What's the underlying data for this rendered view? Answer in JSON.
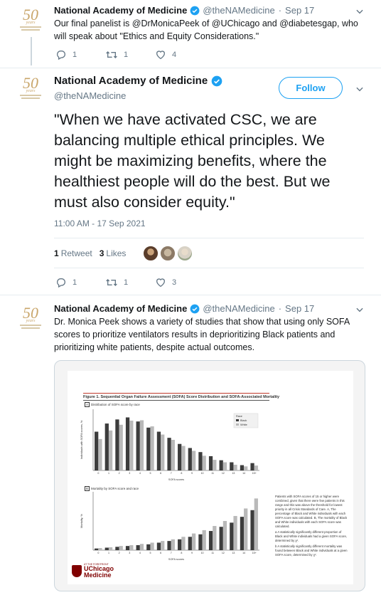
{
  "tweets": [
    {
      "author": "National Academy of Medicine",
      "handle": "@theNAMedicine",
      "separator": "·",
      "time": "Sep 17",
      "text_line1": "Our final panelist is @DrMonicaPeek of @UChicago and @diabetesgap, who",
      "text_line2": "will speak about \"Ethics and Equity Considerations.\"",
      "replies": "1",
      "retweets": "1",
      "likes": "4"
    },
    {
      "author": "National Academy of Medicine",
      "handle": "@theNAMedicine",
      "follow_label": "Follow",
      "text_lines": [
        "\"When we have activated CSC, we are",
        "balancing multiple ethical principles. We",
        "might be maximizing benefits, where the",
        "healthiest people will do the best. But we",
        "must also consider equity.\""
      ],
      "timestamp": "11:00 AM - 17 Sep 2021",
      "retweet_count": "1",
      "retweet_label": "Retweet",
      "like_count": "3",
      "like_label": "Likes",
      "replies": "1",
      "retweets": "1",
      "likes": "3"
    },
    {
      "author": "National Academy of Medicine",
      "handle": "@theNAMedicine",
      "separator": "·",
      "time": "Sep 17",
      "text_lines": [
        "Dr. Monica Peek shows a variety of studies that show that using only SOFA",
        "scores to prioritize ventilators results in deprioritizing Black patients and",
        "prioritizing white patients, despite actual outcomes."
      ]
    }
  ],
  "logo": {
    "fifty": "50",
    "years": "years"
  },
  "figure": {
    "title": "Figure 1. Sequential Organ Failure Assessment (SOFA) Score Distribution and SOFA-Associated Mortality",
    "panel_a_letter": "A",
    "panel_a_label": "Distribution of SOFA score by race",
    "panel_b_letter": "B",
    "panel_b_label": "Mortality by SOFA score and race",
    "xlabel": "SOFA scores",
    "ylabel_a": "Individuals with SOFA scores, %",
    "ylabel_b": "Mortality, %",
    "legend_title": "Race",
    "legend_black": "Black",
    "legend_white": "White",
    "note_main": "Patients with SOFA scores of 15 or higher were combined, given that there were few patients in this range and this was above the threshold for lowest priority in all Crisis Standards of Care. A, The percentage of Black and White individuals with each SOFA score was calculated. B, The mortality of Black and White individuals with each SOFA score was calculated.",
    "note_a": "a A statistically significantly different proportion of Black and White individuals had a given SOFA score, determined by χ².",
    "note_b": "b A statistically significantly different mortality was found between Black and White individuals at a given SOFA score, determined by χ².",
    "brand_top": "AT THE FOREFRONT",
    "brand_line1": "UChicago",
    "brand_line2": "Medicine"
  },
  "colors": {
    "accent": "#1da1f2",
    "black_series": "#3c3c3c",
    "white_series": "#b9b9b9",
    "brand": "#800000"
  }
}
